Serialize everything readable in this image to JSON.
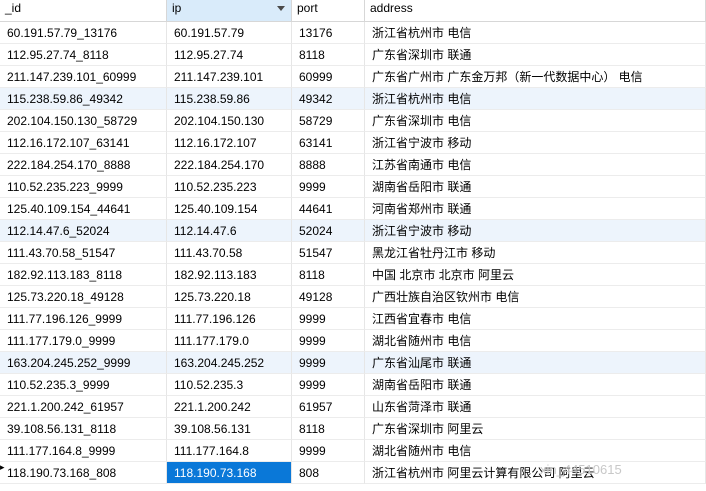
{
  "columns": [
    "_id",
    "ip",
    "port",
    "address"
  ],
  "rows": [
    [
      "60.191.57.79_13176",
      "60.191.57.79",
      "13176",
      "浙江省杭州市 电信"
    ],
    [
      "112.95.27.74_8118",
      "112.95.27.74",
      "8118",
      "广东省深圳市 联通"
    ],
    [
      "211.147.239.101_60999",
      "211.147.239.101",
      "60999",
      "广东省广州市 广东金万邦（新一代数据中心） 电信"
    ],
    [
      "115.238.59.86_49342",
      "115.238.59.86",
      "49342",
      "浙江省杭州市 电信"
    ],
    [
      "202.104.150.130_58729",
      "202.104.150.130",
      "58729",
      "广东省深圳市 电信"
    ],
    [
      "112.16.172.107_63141",
      "112.16.172.107",
      "63141",
      "浙江省宁波市 移动"
    ],
    [
      "222.184.254.170_8888",
      "222.184.254.170",
      "8888",
      "江苏省南通市 电信"
    ],
    [
      "110.52.235.223_9999",
      "110.52.235.223",
      "9999",
      "湖南省岳阳市 联通"
    ],
    [
      "125.40.109.154_44641",
      "125.40.109.154",
      "44641",
      "河南省郑州市 联通"
    ],
    [
      "112.14.47.6_52024",
      "112.14.47.6",
      "52024",
      "浙江省宁波市 移动"
    ],
    [
      "111.43.70.58_51547",
      "111.43.70.58",
      "51547",
      "黑龙江省牡丹江市 移动"
    ],
    [
      "182.92.113.183_8118",
      "182.92.113.183",
      "8118",
      "中国 北京市 北京市 阿里云"
    ],
    [
      "125.73.220.18_49128",
      "125.73.220.18",
      "49128",
      "广西壮族自治区钦州市 电信"
    ],
    [
      "111.77.196.126_9999",
      "111.77.196.126",
      "9999",
      "江西省宜春市 电信"
    ],
    [
      "111.177.179.0_9999",
      "111.177.179.0",
      "9999",
      "湖北省随州市 电信"
    ],
    [
      "163.204.245.252_9999",
      "163.204.245.252",
      "9999",
      "广东省汕尾市 联通"
    ],
    [
      "110.52.235.3_9999",
      "110.52.235.3",
      "9999",
      "湖南省岳阳市 联通"
    ],
    [
      "221.1.200.242_61957",
      "221.1.200.242",
      "61957",
      "山东省菏泽市 联通"
    ],
    [
      "39.108.56.131_8118",
      "39.108.56.131",
      "8118",
      "广东省深圳市 阿里云"
    ],
    [
      "111.177.164.8_9999",
      "111.177.164.8",
      "9999",
      "湖北省随州市 电信"
    ],
    [
      "118.190.73.168_808",
      "118.190.73.168",
      "808",
      "浙江省杭州市 阿里云计算有限公司 阿里云"
    ]
  ],
  "row_marker": "▸",
  "watermark": "xin_44510615",
  "colors": {
    "alt_row": "#edf4fc",
    "selected": "#0a78d8",
    "sorted_header": "#d9ebfa"
  },
  "icons": {
    "sort": "sort-desc-icon"
  }
}
